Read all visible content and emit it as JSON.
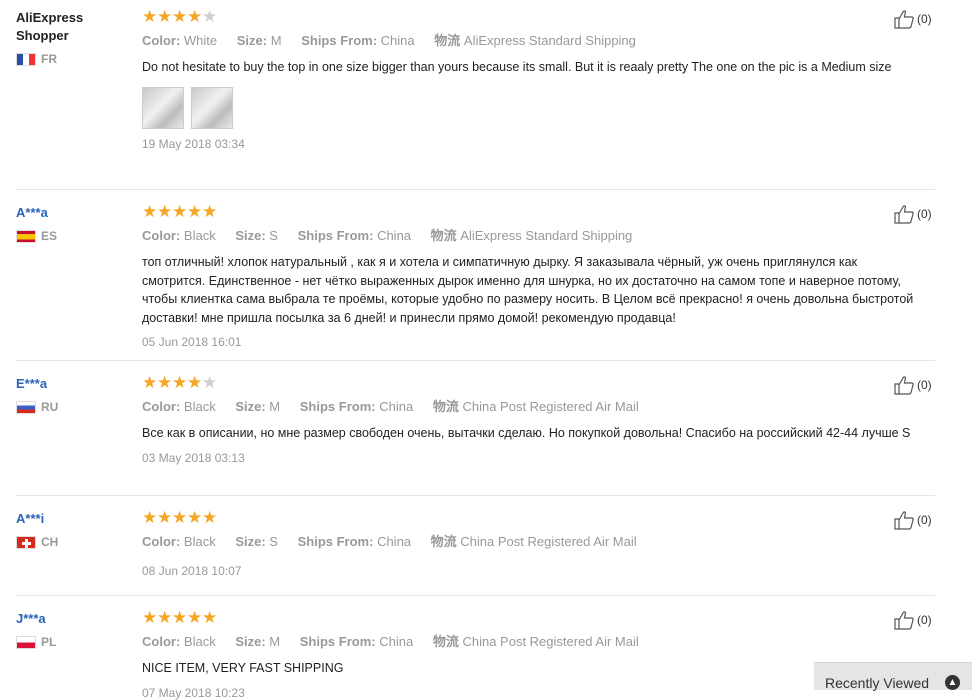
{
  "labels": {
    "color": "Color:",
    "size": "Size:",
    "ships_from": "Ships From:",
    "logistics": "物流"
  },
  "reviews": [
    {
      "user": "AliExpress Shopper",
      "country": "FR",
      "rating": 4,
      "color": "White",
      "size": "M",
      "ships_from": "China",
      "shipping": "AliExpress Standard Shipping",
      "text": "Do not hesitate to buy the top in one size bigger than yours because its small. But it is reaaly pretty The one on the pic is a Medium size",
      "photos": 2,
      "date": "19 May 2018 03:34",
      "helpful": "(0)"
    },
    {
      "user": "A***a",
      "country": "ES",
      "rating": 5,
      "color": "Black",
      "size": "S",
      "ships_from": "China",
      "shipping": "AliExpress Standard Shipping",
      "text": "топ отличный! хлопок натуральный , как я и хотела и симпатичную дырку. Я заказывала чёрный, уж очень приглянулся как смотрится. Единственное - нет чётко выраженных дырок именно для шнурка, но их достаточно на самом топе и наверное потому, чтобы клиентка сама выбрала те проёмы, которые удобно по размеру носить. В Целом всё прекрасно! я очень довольна быстротой доставки! мне пришла посылка за 6 дней! и принесли прямо домой! рекомендую продавца!",
      "date": "05 Jun 2018 16:01",
      "helpful": "(0)"
    },
    {
      "user": "E***a",
      "country": "RU",
      "rating": 4,
      "color": "Black",
      "size": "M",
      "ships_from": "China",
      "shipping": "China Post Registered Air Mail",
      "text": "Все как в описании, но мне размер свободен очень, вытачки сделаю. Но покупкой довольна! Спасибо на российский 42-44 лучше S",
      "date": "03 May 2018 03:13",
      "helpful": "(0)"
    },
    {
      "user": "A***i",
      "country": "CH",
      "rating": 5,
      "color": "Black",
      "size": "S",
      "ships_from": "China",
      "shipping": "China Post Registered Air Mail",
      "text": "",
      "date": "08 Jun 2018 10:07",
      "helpful": "(0)"
    },
    {
      "user": "J***a",
      "country": "PL",
      "rating": 5,
      "color": "Black",
      "size": "M",
      "ships_from": "China",
      "shipping": "China Post Registered Air Mail",
      "text": "NICE ITEM, VERY FAST SHIPPING",
      "date": "07 May 2018 10:23",
      "helpful": "(0)"
    }
  ],
  "recently_viewed": {
    "label": "Recently Viewed",
    "icon": "chevron-up-circle-icon"
  },
  "colors": {
    "star": "#f5a623",
    "star_empty": "#cfcfcf",
    "masked_user": "#2a64b8"
  }
}
